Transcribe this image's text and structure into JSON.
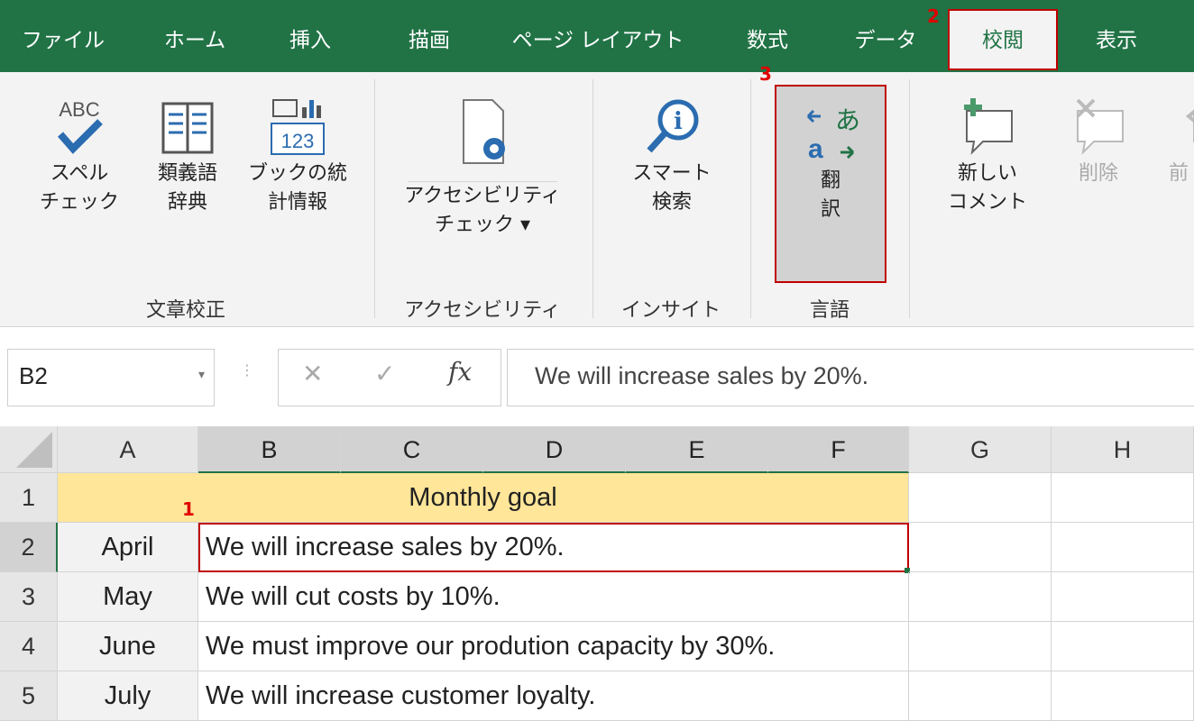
{
  "ribbon_tabs": [
    "ファイル",
    "ホーム",
    "挿入",
    "描画",
    "ページ レイアウト",
    "数式",
    "データ",
    "校閲",
    "表示"
  ],
  "active_tab": "校閲",
  "markers": {
    "one": "1",
    "two": "2",
    "three": "3"
  },
  "groups": {
    "proofing": {
      "label": "文章校正",
      "spelling": [
        "スペル",
        "チェック"
      ],
      "thesaurus": [
        "類義語",
        "辞典"
      ],
      "workbook_stats": [
        "ブックの統",
        "計情報"
      ]
    },
    "accessibility": {
      "label": "アクセシビリティ",
      "check": [
        "アクセシビリティ",
        "チェック ▾"
      ]
    },
    "insights": {
      "label": "インサイト",
      "smart_lookup": [
        "スマート",
        "検索"
      ]
    },
    "language": {
      "label": "言語",
      "translate": [
        "翻",
        "訳"
      ]
    },
    "comments": {
      "new_comment": [
        "新しい",
        "コメント"
      ],
      "delete": "削除",
      "previous": "前"
    }
  },
  "formula_bar": {
    "name_box": "B2",
    "fx": "fx",
    "formula": "We will increase sales by 20%."
  },
  "columns": [
    "A",
    "B",
    "C",
    "D",
    "E",
    "F",
    "G",
    "H"
  ],
  "rows": [
    {
      "num": "1",
      "a": "",
      "b": "Monthly goal"
    },
    {
      "num": "2",
      "a": "April",
      "b": "We will increase sales by 20%."
    },
    {
      "num": "3",
      "a": "May",
      "b": "We will cut costs by 10%."
    },
    {
      "num": "4",
      "a": "June",
      "b": "We must improve our prodution capacity by 30%."
    },
    {
      "num": "5",
      "a": "July",
      "b": "We will increase customer loyalty."
    }
  ],
  "colors": {
    "excel_green": "#217346",
    "header_fill": "#ffe699",
    "highlight": "#c00000"
  }
}
